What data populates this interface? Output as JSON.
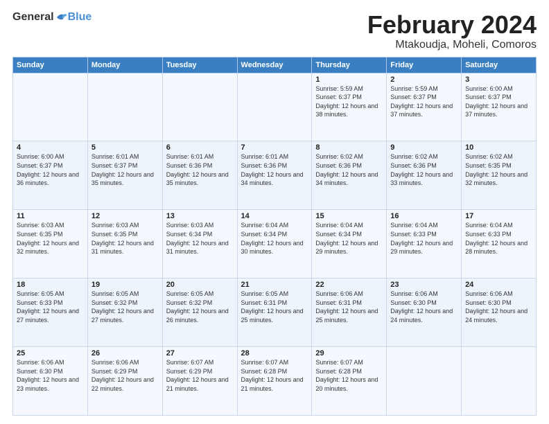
{
  "logo": {
    "general": "General",
    "blue": "Blue"
  },
  "header": {
    "month": "February 2024",
    "location": "Mtakoudja, Moheli, Comoros"
  },
  "weekdays": [
    "Sunday",
    "Monday",
    "Tuesday",
    "Wednesday",
    "Thursday",
    "Friday",
    "Saturday"
  ],
  "weeks": [
    [
      {
        "day": "",
        "sunrise": "",
        "sunset": "",
        "daylight": ""
      },
      {
        "day": "",
        "sunrise": "",
        "sunset": "",
        "daylight": ""
      },
      {
        "day": "",
        "sunrise": "",
        "sunset": "",
        "daylight": ""
      },
      {
        "day": "",
        "sunrise": "",
        "sunset": "",
        "daylight": ""
      },
      {
        "day": "1",
        "sunrise": "Sunrise: 5:59 AM",
        "sunset": "Sunset: 6:37 PM",
        "daylight": "Daylight: 12 hours and 38 minutes."
      },
      {
        "day": "2",
        "sunrise": "Sunrise: 5:59 AM",
        "sunset": "Sunset: 6:37 PM",
        "daylight": "Daylight: 12 hours and 37 minutes."
      },
      {
        "day": "3",
        "sunrise": "Sunrise: 6:00 AM",
        "sunset": "Sunset: 6:37 PM",
        "daylight": "Daylight: 12 hours and 37 minutes."
      }
    ],
    [
      {
        "day": "4",
        "sunrise": "Sunrise: 6:00 AM",
        "sunset": "Sunset: 6:37 PM",
        "daylight": "Daylight: 12 hours and 36 minutes."
      },
      {
        "day": "5",
        "sunrise": "Sunrise: 6:01 AM",
        "sunset": "Sunset: 6:37 PM",
        "daylight": "Daylight: 12 hours and 35 minutes."
      },
      {
        "day": "6",
        "sunrise": "Sunrise: 6:01 AM",
        "sunset": "Sunset: 6:36 PM",
        "daylight": "Daylight: 12 hours and 35 minutes."
      },
      {
        "day": "7",
        "sunrise": "Sunrise: 6:01 AM",
        "sunset": "Sunset: 6:36 PM",
        "daylight": "Daylight: 12 hours and 34 minutes."
      },
      {
        "day": "8",
        "sunrise": "Sunrise: 6:02 AM",
        "sunset": "Sunset: 6:36 PM",
        "daylight": "Daylight: 12 hours and 34 minutes."
      },
      {
        "day": "9",
        "sunrise": "Sunrise: 6:02 AM",
        "sunset": "Sunset: 6:36 PM",
        "daylight": "Daylight: 12 hours and 33 minutes."
      },
      {
        "day": "10",
        "sunrise": "Sunrise: 6:02 AM",
        "sunset": "Sunset: 6:35 PM",
        "daylight": "Daylight: 12 hours and 32 minutes."
      }
    ],
    [
      {
        "day": "11",
        "sunrise": "Sunrise: 6:03 AM",
        "sunset": "Sunset: 6:35 PM",
        "daylight": "Daylight: 12 hours and 32 minutes."
      },
      {
        "day": "12",
        "sunrise": "Sunrise: 6:03 AM",
        "sunset": "Sunset: 6:35 PM",
        "daylight": "Daylight: 12 hours and 31 minutes."
      },
      {
        "day": "13",
        "sunrise": "Sunrise: 6:03 AM",
        "sunset": "Sunset: 6:34 PM",
        "daylight": "Daylight: 12 hours and 31 minutes."
      },
      {
        "day": "14",
        "sunrise": "Sunrise: 6:04 AM",
        "sunset": "Sunset: 6:34 PM",
        "daylight": "Daylight: 12 hours and 30 minutes."
      },
      {
        "day": "15",
        "sunrise": "Sunrise: 6:04 AM",
        "sunset": "Sunset: 6:34 PM",
        "daylight": "Daylight: 12 hours and 29 minutes."
      },
      {
        "day": "16",
        "sunrise": "Sunrise: 6:04 AM",
        "sunset": "Sunset: 6:33 PM",
        "daylight": "Daylight: 12 hours and 29 minutes."
      },
      {
        "day": "17",
        "sunrise": "Sunrise: 6:04 AM",
        "sunset": "Sunset: 6:33 PM",
        "daylight": "Daylight: 12 hours and 28 minutes."
      }
    ],
    [
      {
        "day": "18",
        "sunrise": "Sunrise: 6:05 AM",
        "sunset": "Sunset: 6:33 PM",
        "daylight": "Daylight: 12 hours and 27 minutes."
      },
      {
        "day": "19",
        "sunrise": "Sunrise: 6:05 AM",
        "sunset": "Sunset: 6:32 PM",
        "daylight": "Daylight: 12 hours and 27 minutes."
      },
      {
        "day": "20",
        "sunrise": "Sunrise: 6:05 AM",
        "sunset": "Sunset: 6:32 PM",
        "daylight": "Daylight: 12 hours and 26 minutes."
      },
      {
        "day": "21",
        "sunrise": "Sunrise: 6:05 AM",
        "sunset": "Sunset: 6:31 PM",
        "daylight": "Daylight: 12 hours and 25 minutes."
      },
      {
        "day": "22",
        "sunrise": "Sunrise: 6:06 AM",
        "sunset": "Sunset: 6:31 PM",
        "daylight": "Daylight: 12 hours and 25 minutes."
      },
      {
        "day": "23",
        "sunrise": "Sunrise: 6:06 AM",
        "sunset": "Sunset: 6:30 PM",
        "daylight": "Daylight: 12 hours and 24 minutes."
      },
      {
        "day": "24",
        "sunrise": "Sunrise: 6:06 AM",
        "sunset": "Sunset: 6:30 PM",
        "daylight": "Daylight: 12 hours and 24 minutes."
      }
    ],
    [
      {
        "day": "25",
        "sunrise": "Sunrise: 6:06 AM",
        "sunset": "Sunset: 6:30 PM",
        "daylight": "Daylight: 12 hours and 23 minutes."
      },
      {
        "day": "26",
        "sunrise": "Sunrise: 6:06 AM",
        "sunset": "Sunset: 6:29 PM",
        "daylight": "Daylight: 12 hours and 22 minutes."
      },
      {
        "day": "27",
        "sunrise": "Sunrise: 6:07 AM",
        "sunset": "Sunset: 6:29 PM",
        "daylight": "Daylight: 12 hours and 21 minutes."
      },
      {
        "day": "28",
        "sunrise": "Sunrise: 6:07 AM",
        "sunset": "Sunset: 6:28 PM",
        "daylight": "Daylight: 12 hours and 21 minutes."
      },
      {
        "day": "29",
        "sunrise": "Sunrise: 6:07 AM",
        "sunset": "Sunset: 6:28 PM",
        "daylight": "Daylight: 12 hours and 20 minutes."
      },
      {
        "day": "",
        "sunrise": "",
        "sunset": "",
        "daylight": ""
      },
      {
        "day": "",
        "sunrise": "",
        "sunset": "",
        "daylight": ""
      }
    ]
  ]
}
